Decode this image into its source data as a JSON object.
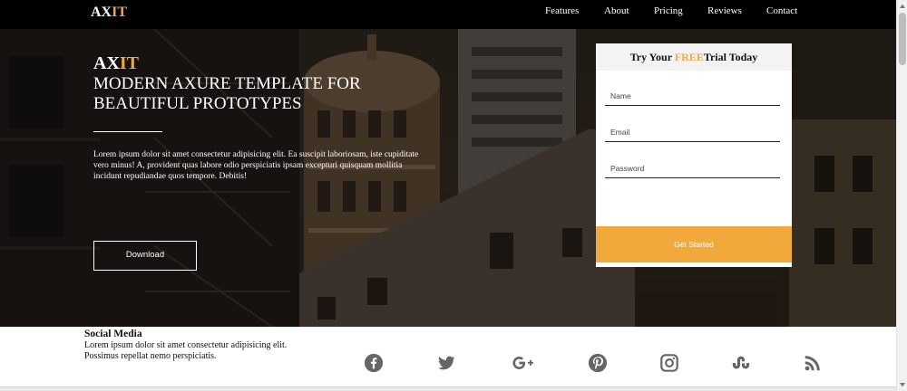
{
  "nav": {
    "logo_main": "AX",
    "logo_accent": "IT",
    "links": [
      "Features",
      "About",
      "Pricing",
      "Reviews",
      "Contact"
    ]
  },
  "hero": {
    "brand_main": "AX",
    "brand_accent": "IT",
    "title": "MODERN AXURE TEMPLATE FOR BEAUTIFUL PROTOTYPES",
    "text": "Lorem ipsum dolor sit amet consectetur adipisicing elit. Ea suscipit laboriosam, iste cupiditate vero minus! A, provident quas labore odio perspiciatis ipsam excepturi quisquam mollitia incidunt repudiandae quos tempore. Debitis!",
    "download_label": "Download"
  },
  "trial": {
    "title_pre": "Try Your ",
    "title_accent": "FREE",
    "title_post": "Trial Today",
    "name_placeholder": "Name",
    "email_placeholder": "Email",
    "password_placeholder": "Password",
    "button_label": "Get Started"
  },
  "social": {
    "title": "Social Media",
    "text": "Lorem ipsum dolor sit amet consectetur adipisicing elit. Possimus repellat nemo perspiciatis.",
    "icons": [
      "facebook-icon",
      "twitter-icon",
      "google-plus-icon",
      "pinterest-icon",
      "instagram-icon",
      "stumbleupon-icon",
      "rss-icon"
    ]
  },
  "colors": {
    "accent": "#f2a93b",
    "nav_bg": "#000000",
    "icon_gray": "#666666"
  }
}
